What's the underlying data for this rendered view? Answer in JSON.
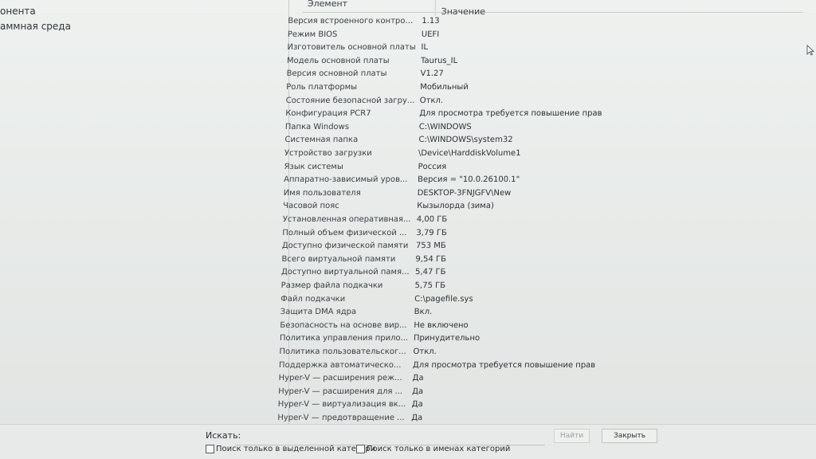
{
  "left_tree": {
    "items": [
      {
        "label": "онента"
      },
      {
        "label": "аммная среда"
      }
    ]
  },
  "table": {
    "headers": {
      "element": "Элемент",
      "value": "Значение"
    },
    "rows": [
      {
        "name": "Версия встроенного контрол...",
        "value": "1.13"
      },
      {
        "name": "Режим BIOS",
        "value": "UEFI"
      },
      {
        "name": "Изготовитель основной платы",
        "value": "IL"
      },
      {
        "name": "Модель основной платы",
        "value": "Taurus_IL"
      },
      {
        "name": "Версия основной платы",
        "value": "V1.27"
      },
      {
        "name": "Роль платформы",
        "value": "Мобильный"
      },
      {
        "name": "Состояние безопасной загру...",
        "value": "Откл."
      },
      {
        "name": "Конфигурация PCR7",
        "value": "Для просмотра требуется повышение прав"
      },
      {
        "name": "Папка Windows",
        "value": "C:\\WINDOWS"
      },
      {
        "name": "Системная папка",
        "value": "C:\\WINDOWS\\system32"
      },
      {
        "name": "Устройство загрузки",
        "value": "\\Device\\HarddiskVolume1"
      },
      {
        "name": "Язык системы",
        "value": "Россия"
      },
      {
        "name": "Аппаратно-зависимый уров...",
        "value": "Версия = \"10.0.26100.1\""
      },
      {
        "name": "Имя пользователя",
        "value": "DESKTOP-3FNJGFV\\New"
      },
      {
        "name": "Часовой пояс",
        "value": "Кызылорда (зима)"
      },
      {
        "name": "Установленная оперативная...",
        "value": "4,00 ГБ"
      },
      {
        "name": "Полный объем физической ...",
        "value": "3,79 ГБ"
      },
      {
        "name": "Доступно физической памяти",
        "value": "753 МБ"
      },
      {
        "name": "Всего виртуальной памяти",
        "value": "9,54 ГБ"
      },
      {
        "name": "Доступно виртуальной памя...",
        "value": "5,47 ГБ"
      },
      {
        "name": "Размер файла подкачки",
        "value": "5,75 ГБ"
      },
      {
        "name": "Файл подкачки",
        "value": "C:\\pagefile.sys"
      },
      {
        "name": "Защита DMA ядра",
        "value": "Вкл."
      },
      {
        "name": "Безопасность на основе вир...",
        "value": "Не включено"
      },
      {
        "name": "Политика управления прило...",
        "value": "Принудительно"
      },
      {
        "name": "Политика пользовательског...",
        "value": "Откл."
      },
      {
        "name": "Поддержка автоматическо...",
        "value": "Для просмотра требуется повышение прав"
      },
      {
        "name": "Hyper-V — расширения реж...",
        "value": "Да"
      },
      {
        "name": "Hyper-V — расширения для ...",
        "value": "Да"
      },
      {
        "name": "Hyper-V — виртуализация вк...",
        "value": "Да"
      },
      {
        "name": "Hyper-V — предотвращение ...",
        "value": "Да"
      }
    ]
  },
  "search": {
    "label": "Искать:",
    "value": "",
    "find_button": "Найти",
    "close_button": "Закрыть",
    "checkbox_selected_category": "Поиск только в выделенной категори",
    "checkbox_category_names": "Поиск только в именах категорий"
  },
  "colors": {
    "background": "#e9ecea",
    "text": "#2b2f33",
    "separator": "#c9cdca"
  }
}
